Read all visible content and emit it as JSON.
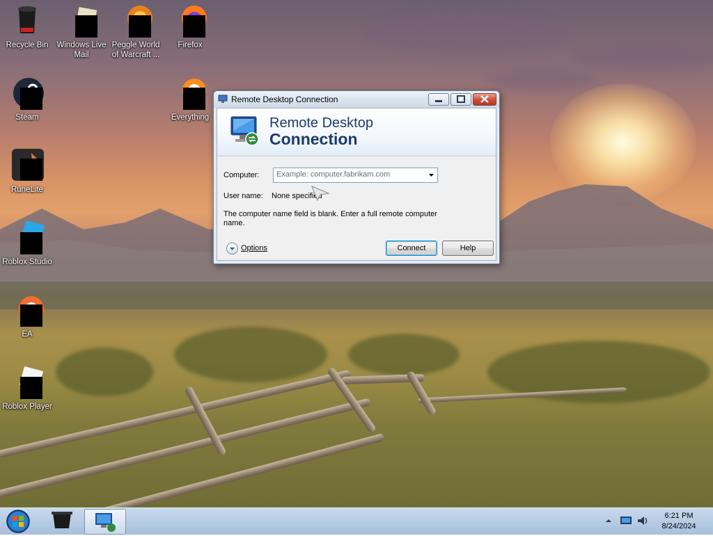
{
  "desktop": {
    "icons": [
      {
        "label": "Recycle Bin"
      },
      {
        "label": "Windows Live Mail"
      },
      {
        "label": "Peggle World of Warcraft ..."
      },
      {
        "label": "Firefox"
      },
      {
        "label": "Steam"
      },
      {
        "label": "Everything"
      },
      {
        "label": "RuneLite"
      },
      {
        "label": "Roblox Studio"
      },
      {
        "label": "EA"
      },
      {
        "label": "Roblox Player"
      }
    ]
  },
  "window": {
    "title": "Remote Desktop Connection",
    "banner_line1": "Remote Desktop",
    "banner_line2": "Connection",
    "computer_label": "Computer:",
    "computer_placeholder": "Example: computer.fabrikam.com",
    "computer_value": "",
    "username_label": "User name:",
    "username_value": "None specified",
    "message": "The computer name field is blank. Enter a full remote computer name.",
    "options_label": "Options",
    "connect_label": "Connect",
    "help_label": "Help"
  },
  "taskbar": {
    "time": "6:21 PM",
    "date": "8/24/2024"
  },
  "colors": {
    "title_text": "#1a3b6c",
    "taskbar": "#b9cde4",
    "default_button_border": "#3c7fb1"
  }
}
